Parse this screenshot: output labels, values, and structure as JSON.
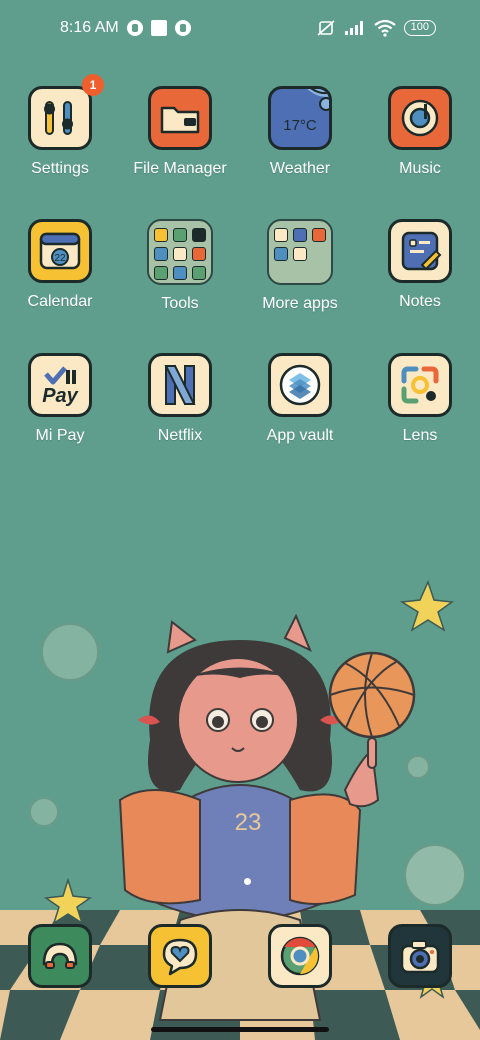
{
  "status_bar": {
    "time": "8:16 AM",
    "battery": "100",
    "icons": [
      "data-saver-icon",
      "notification-square-icon",
      "data-saver-icon",
      "mute-icon",
      "signal-icon",
      "wifi-icon",
      "battery-icon"
    ]
  },
  "apps_row1": [
    {
      "label": "Settings",
      "icon": "settings-icon",
      "badge": "1"
    },
    {
      "label": "File Manager",
      "icon": "folder-icon"
    },
    {
      "label": "Weather",
      "icon": "weather-icon",
      "temp": "17°C"
    },
    {
      "label": "Music",
      "icon": "music-icon"
    }
  ],
  "apps_row2": [
    {
      "label": "Calendar",
      "icon": "calendar-icon",
      "day": "22"
    },
    {
      "label": "Tools",
      "icon": "folder-icon"
    },
    {
      "label": "More apps",
      "icon": "folder-icon"
    },
    {
      "label": "Notes",
      "icon": "notes-icon"
    }
  ],
  "apps_row3": [
    {
      "label": "Mi Pay",
      "icon": "mi-pay-icon",
      "text": "Pay"
    },
    {
      "label": "Netflix",
      "icon": "netflix-icon",
      "text": "N"
    },
    {
      "label": "App vault",
      "icon": "app-vault-icon"
    },
    {
      "label": "Lens",
      "icon": "lens-icon"
    }
  ],
  "dock": [
    {
      "icon": "phone-icon"
    },
    {
      "icon": "messages-icon"
    },
    {
      "icon": "chrome-icon"
    },
    {
      "icon": "camera-icon"
    }
  ],
  "colors": {
    "background": "#5f9e8c",
    "tile_cream": "#fbe9c6",
    "accent_orange": "#e8683a",
    "accent_yellow": "#f6c233",
    "accent_blue": "#4f6fb5",
    "outline": "#1c2b2a"
  }
}
